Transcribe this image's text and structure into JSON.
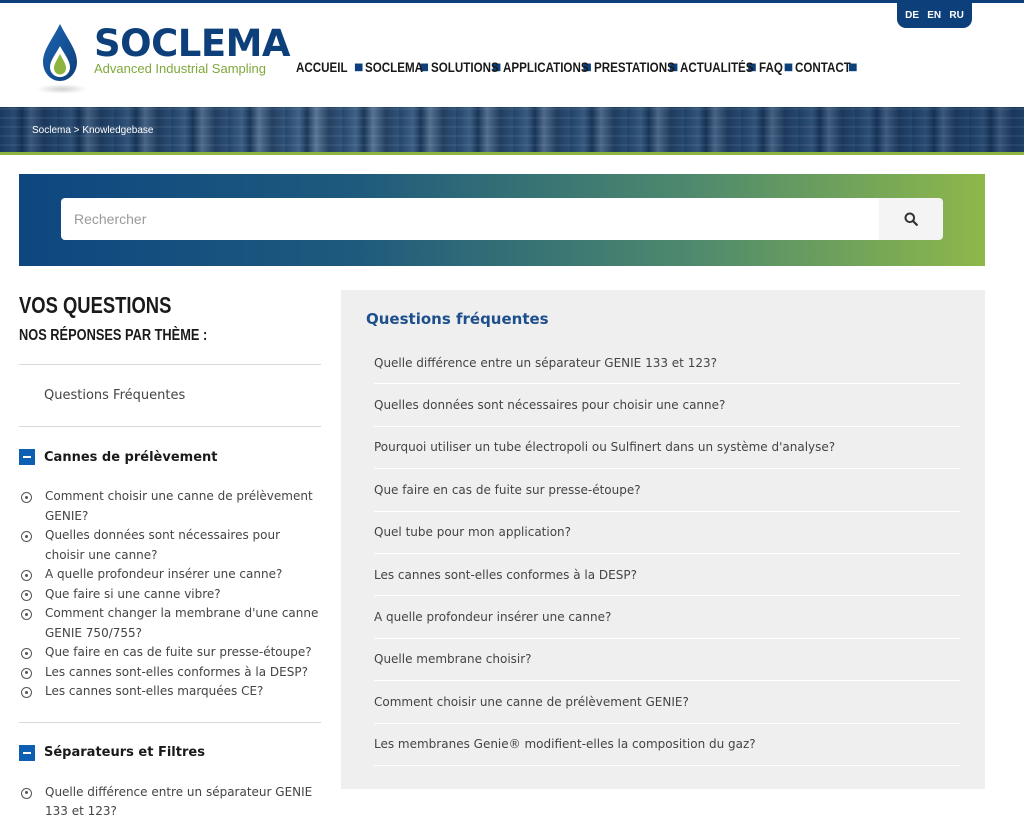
{
  "language": {
    "items": [
      "DE",
      "EN",
      "RU"
    ]
  },
  "logo": {
    "name": "SOCLEMA",
    "tagline": "Advanced Industrial Sampling"
  },
  "nav": {
    "items": [
      "ACCUEIL",
      "SOCLEMA",
      "SOLUTIONS",
      "APPLICATIONS",
      "PRESTATIONS",
      "ACTUALITÉS",
      "FAQ",
      "CONTACT"
    ]
  },
  "breadcrumb": {
    "home": "Soclema",
    "separator": " > ",
    "current": "Knowledgebase"
  },
  "search": {
    "placeholder": "Rechercher",
    "icon": "search-icon"
  },
  "sidebar": {
    "title": "VOS QUESTIONS",
    "subtitle": "NOS RÉPONSES PAR THÈME :",
    "faq_link": "Questions Fréquentes",
    "sections": [
      {
        "title": "Cannes de prélèvement",
        "items": [
          "Comment choisir une canne de prélèvement GENIE?",
          "Quelles données sont nécessaires pour choisir une canne?",
          "A quelle profondeur insérer une canne?",
          "Que faire si une canne vibre?",
          "Comment changer la membrane d'une canne GENIE 750/755?",
          "Que faire en cas de fuite sur presse-étoupe?",
          "Les cannes sont-elles conformes à la DESP?",
          "Les cannes sont-elles marquées CE?"
        ]
      },
      {
        "title": "Séparateurs et Filtres",
        "items": [
          "Quelle différence entre un séparateur GENIE 133 et 123?"
        ]
      }
    ]
  },
  "faq_panel": {
    "title": "Questions fréquentes",
    "items": [
      "Quelle différence entre un séparateur GENIE 133 et 123?",
      "Quelles données sont nécessaires pour choisir une canne?",
      "Pourquoi utiliser un tube électropoli ou Sulfinert dans un système d'analyse?",
      "Que faire en cas de fuite sur presse-étoupe?",
      "Quel tube pour mon application?",
      "Les cannes sont-elles conformes à la DESP?",
      "A quelle profondeur insérer une canne?",
      "Quelle membrane choisir?",
      "Comment choisir une canne de prélèvement GENIE?",
      "Les membranes Genie® modifient-elles la composition du gaz?"
    ]
  },
  "colors": {
    "brand_blue": "#0d3f7a",
    "brand_green": "#8cb43f",
    "link_blue": "#1d4f8c",
    "toggle_blue": "#0d5fb4"
  }
}
